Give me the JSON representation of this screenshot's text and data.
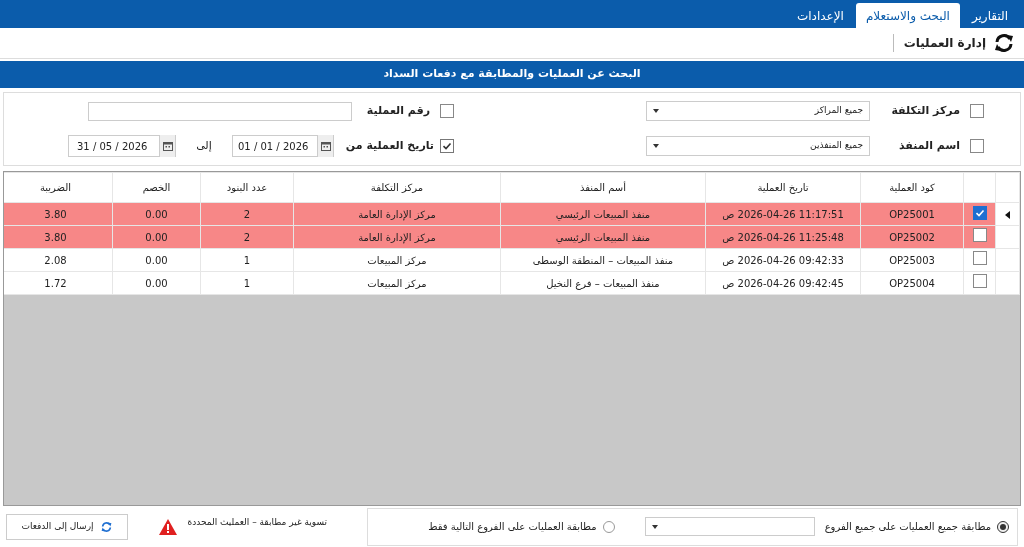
{
  "tabs": [
    {
      "label": "التقارير",
      "selected": false
    },
    {
      "label": "البحث والاستعلام",
      "selected": true
    },
    {
      "label": "الإعدادات",
      "selected": false
    }
  ],
  "toolbar": {
    "title": "إدارة العمليات"
  },
  "banner": "البحث عن العمليات والمطابقة مع دفعات السداد",
  "filters": {
    "cost_center": {
      "label": "مركز التكلفة",
      "checked": false,
      "value": "جميع المراكز"
    },
    "operation_number": {
      "label": "رقم العملية",
      "checked": false
    },
    "executor": {
      "label": "اسم المنفذ",
      "checked": false,
      "value": "جميع المنفذين"
    },
    "date": {
      "label": "تاريخ العملية من",
      "checked": true,
      "from": "01 / 01 / 2026",
      "to_label": "إلى",
      "to": "31 / 05 / 2026"
    }
  },
  "table": {
    "columns": [
      "كود العملية",
      "تاريخ العملية",
      "أسم المنفذ",
      "مركز التكلفة",
      "عدد البنود",
      "الخصم",
      "الضريبة"
    ],
    "rows": [
      {
        "current": true,
        "checked": true,
        "flagged": true,
        "cells": [
          "OP25001",
          "11:17:51  2026-04-26 ص",
          "منفذ المبيعات الرئيسي",
          "مركز الإدارة العامة",
          "2",
          "0.00",
          "3.80"
        ]
      },
      {
        "current": false,
        "checked": false,
        "flagged": true,
        "cells": [
          "OP25002",
          "11:25:48  2026-04-26 ص",
          "منفذ المبيعات الرئيسي",
          "مركز الإدارة العامة",
          "2",
          "0.00",
          "3.80"
        ]
      },
      {
        "current": false,
        "checked": false,
        "flagged": false,
        "cells": [
          "OP25003",
          "09:42:33  2026-04-26 ص",
          "منفذ المبيعات – المنطقة الوسطى",
          "مركز المبيعات",
          "1",
          "0.00",
          "2.08"
        ]
      },
      {
        "current": false,
        "checked": false,
        "flagged": false,
        "cells": [
          "OP25004",
          "09:42:45  2026-04-26 ص",
          "منفذ المبيعات – فرع النخيل",
          "مركز المبيعات",
          "1",
          "0.00",
          "1.72"
        ]
      }
    ]
  },
  "matching": {
    "options": [
      {
        "label": "مطابقة جميع العمليات على جميع الفروع",
        "selected": true
      },
      {
        "label": "مطابقة العمليات على الفروع التالية فقط",
        "selected": false
      }
    ]
  },
  "warning": "تسوية غير مطابقة – العمليث المحددة",
  "send_button": "إرسال إلى الدفعات"
}
